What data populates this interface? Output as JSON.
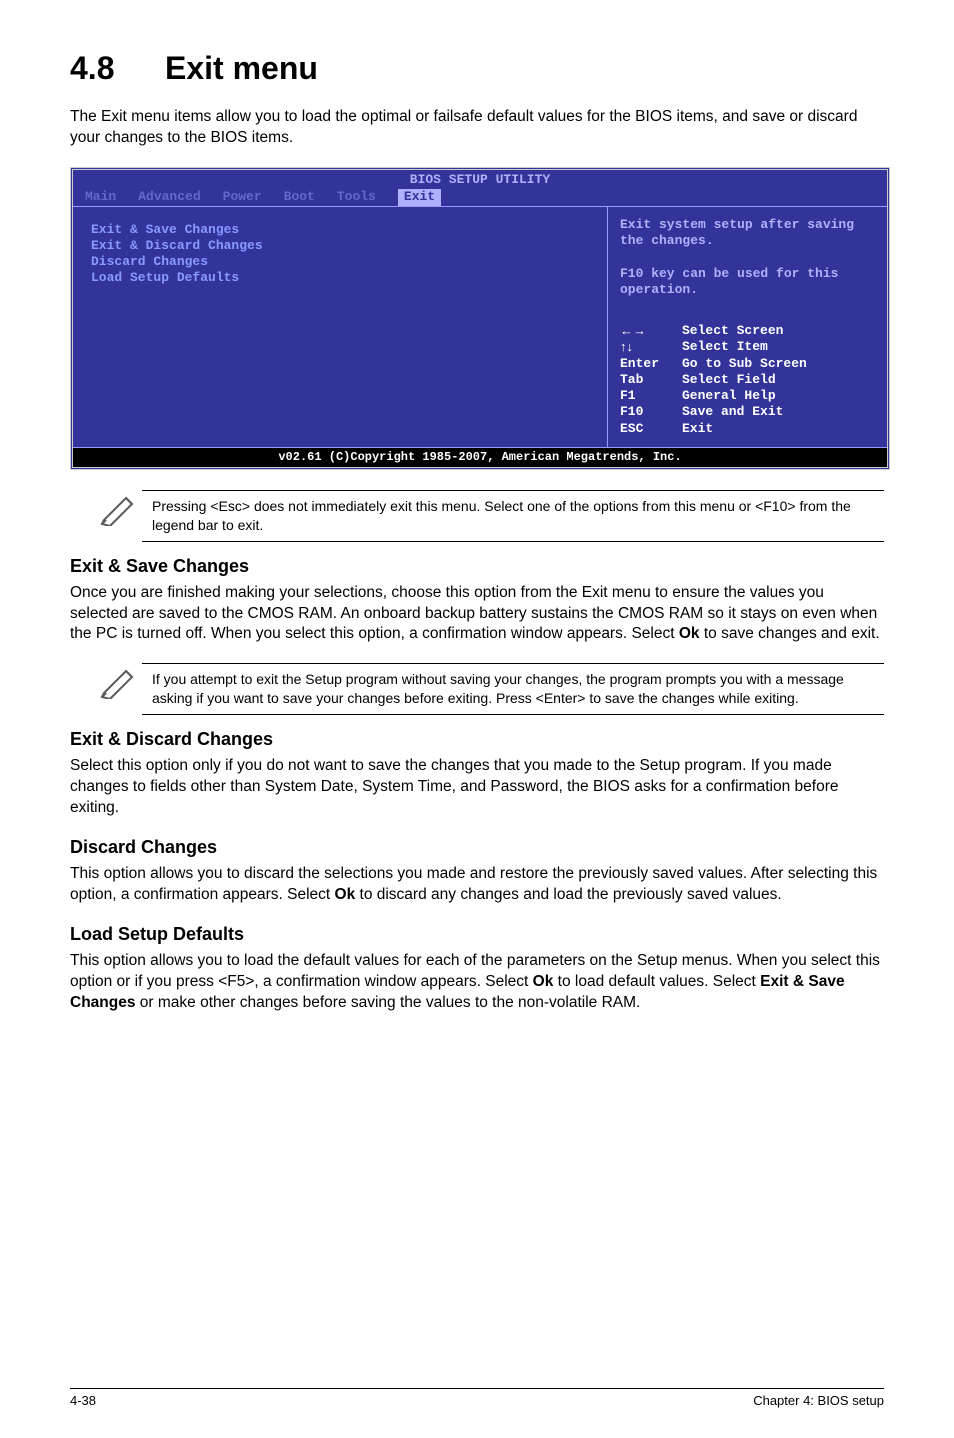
{
  "heading": {
    "num": "4.8",
    "title": "Exit menu"
  },
  "intro": "The Exit menu items allow you to load the optimal or failsafe default values for the BIOS items, and save or discard your changes to the BIOS items.",
  "bios": {
    "titlebar": "BIOS SETUP UTILITY",
    "menus": [
      "Main",
      "Advanced",
      "Power",
      "Boot",
      "Tools",
      "Exit"
    ],
    "active_menu": "Exit",
    "left_items": [
      "Exit & Save Changes",
      "Exit & Discard Changes",
      "Discard Changes",
      "",
      "Load Setup Defaults"
    ],
    "help_top": "Exit system setup after saving the changes.\n\nF10 key can be used for this operation.",
    "keys": [
      {
        "k": "←→",
        "d": "Select Screen"
      },
      {
        "k": "↑↓",
        "d": "Select Item"
      },
      {
        "k": "Enter",
        "d": "Go to Sub Screen"
      },
      {
        "k": "Tab",
        "d": "Select Field"
      },
      {
        "k": "F1",
        "d": "General Help"
      },
      {
        "k": "F10",
        "d": "Save and Exit"
      },
      {
        "k": "ESC",
        "d": "Exit"
      }
    ],
    "footer": "v02.61 (C)Copyright 1985-2007, American Megatrends, Inc."
  },
  "note1": "Pressing <Esc> does not immediately exit this menu. Select one of the options from this menu or <F10> from the legend bar to exit.",
  "sections": {
    "save": {
      "h": "Exit & Save Changes",
      "p": "Once you are finished making your selections, choose this option from the Exit menu to ensure the values you selected are saved to the CMOS RAM. An onboard backup battery sustains the CMOS RAM so it stays on even when the PC is turned off. When you select this option, a confirmation window appears. Select Ok to save changes and exit."
    },
    "note2": "If you attempt to exit the Setup program without saving your changes, the program prompts you with a message asking if you want to save your changes before exiting. Press <Enter> to save the changes while exiting.",
    "discard_exit": {
      "h": "Exit & Discard Changes",
      "p": "Select this option only if you do not want to save the changes that you  made to the Setup program. If you made changes to fields other than System Date, System Time, and Password, the BIOS asks for a confirmation before exiting."
    },
    "discard": {
      "h": "Discard Changes",
      "p": "This option allows you to discard the selections you made and restore the previously saved values. After selecting this option, a confirmation appears. Select Ok to discard any changes and load the previously saved values."
    },
    "defaults": {
      "h": "Load Setup Defaults",
      "p": "This option allows you to load the default values for each of the parameters on the Setup menus. When you select this option or if you press <F5>, a confirmation window appears. Select Ok to load default values. Select Exit & Save Changes or make other changes before saving the values to the non-volatile RAM."
    }
  },
  "footer": {
    "left": "4-38",
    "right": "Chapter 4: BIOS setup"
  }
}
